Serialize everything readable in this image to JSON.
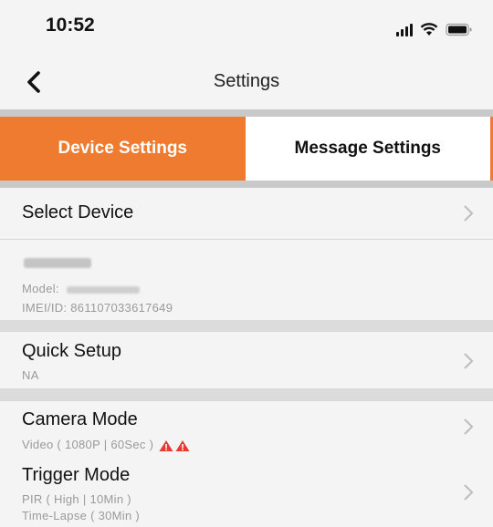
{
  "status_bar": {
    "time": "10:52"
  },
  "nav": {
    "title": "Settings"
  },
  "tabs": {
    "device": "Device Settings",
    "message": "Message Settings"
  },
  "select_device": {
    "title": "Select Device"
  },
  "device_info": {
    "model_label": "Model:",
    "imei": "IMEI/ID: 861107033617649"
  },
  "quick_setup": {
    "title": "Quick Setup",
    "value": "NA"
  },
  "camera_mode": {
    "title": "Camera Mode",
    "value": "Video ( 1080P | 60Sec )"
  },
  "trigger_mode": {
    "title": "Trigger Mode",
    "line1": "PIR ( High | 10Min )",
    "line2": "Time-Lapse ( 30Min )"
  },
  "colors": {
    "accent": "#ee7b2f",
    "warning": "#e53935"
  }
}
